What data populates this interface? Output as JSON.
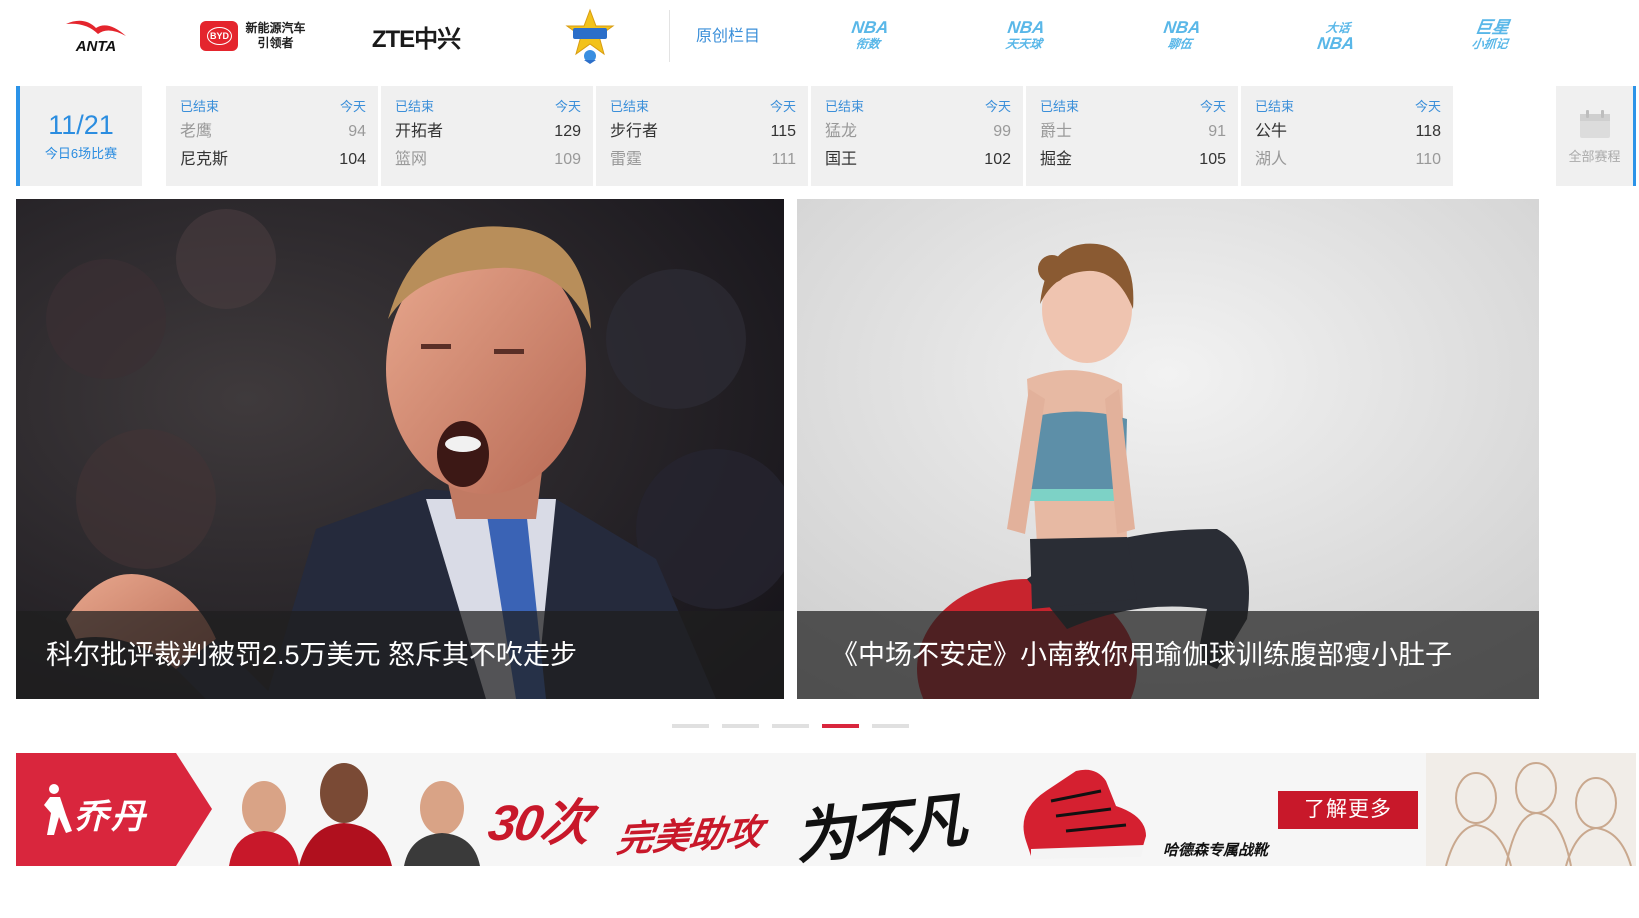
{
  "sponsors": {
    "anta": "ANTA",
    "byd_badge": "BYD",
    "byd_line1": "新能源汽车",
    "byd_line2": "引领者",
    "zte": "ZTE中兴"
  },
  "original_columns": {
    "label": "原创栏目",
    "items": [
      {
        "line1": "NBA",
        "line2": "衔数"
      },
      {
        "line1": "NBA",
        "line2": "天天球"
      },
      {
        "line1": "NBA",
        "line2": "聊伍"
      },
      {
        "line1": "大话",
        "line2": "NBA"
      },
      {
        "line1": "巨星",
        "line2": "小抓记"
      }
    ]
  },
  "schedule": {
    "date": "11/21",
    "summary": "今日6场比赛",
    "all_label": "全部赛程",
    "games": [
      {
        "status": "已结束",
        "day": "今天",
        "away": "老鹰",
        "away_score": "94",
        "home": "尼克斯",
        "home_score": "104",
        "winner": "home"
      },
      {
        "status": "已结束",
        "day": "今天",
        "away": "开拓者",
        "away_score": "129",
        "home": "篮网",
        "home_score": "109",
        "winner": "away"
      },
      {
        "status": "已结束",
        "day": "今天",
        "away": "步行者",
        "away_score": "115",
        "home": "雷霆",
        "home_score": "111",
        "winner": "away"
      },
      {
        "status": "已结束",
        "day": "今天",
        "away": "猛龙",
        "away_score": "99",
        "home": "国王",
        "home_score": "102",
        "winner": "home"
      },
      {
        "status": "已结束",
        "day": "今天",
        "away": "爵士",
        "away_score": "91",
        "home": "掘金",
        "home_score": "105",
        "winner": "home"
      },
      {
        "status": "已结束",
        "day": "今天",
        "away": "公牛",
        "away_score": "118",
        "home": "湖人",
        "home_score": "110",
        "winner": "away"
      }
    ]
  },
  "slides": [
    {
      "caption": "科尔批评裁判被罚2.5万美元 怒斥其不吹走步"
    },
    {
      "caption": "《中场不安定》小南教你用瑜伽球训练腹部瘦小肚子"
    }
  ],
  "pager": {
    "count": 5,
    "active_index": 3
  },
  "banner": {
    "brand": "乔丹",
    "slogan_number": "30次",
    "slogan_text": "完美助攻",
    "slogan_brush": "为不凡",
    "shoe_label": "哈德森专属战靴",
    "cta": "了解更多",
    "brand_color": "#d9263d"
  },
  "colors": {
    "accent_blue": "#2b8de0",
    "active_red": "#d9263d",
    "tile_bg": "#f0f0f0"
  }
}
